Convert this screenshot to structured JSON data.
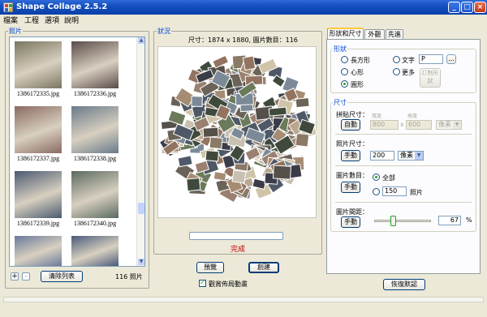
{
  "window": {
    "title": "Shape Collage 2.5.2",
    "min": "_",
    "max": "□",
    "close": "×"
  },
  "menu": [
    "檔案",
    "工程",
    "選項",
    "說明"
  ],
  "photos_panel": {
    "label": "照片",
    "items": [
      {
        "name": "1386172335.jpg",
        "color": "#7a7660"
      },
      {
        "name": "1386172336.jpg",
        "color": "#5a4a48"
      },
      {
        "name": "1386172337.jpg",
        "color": "#8a6a60"
      },
      {
        "name": "1386172338.jpg",
        "color": "#6a7a8a"
      },
      {
        "name": "1386172339.jpg",
        "color": "#4a5a70"
      },
      {
        "name": "1386172340.jpg",
        "color": "#5a6a60"
      },
      {
        "name": "",
        "color": "#6a7a9a"
      },
      {
        "name": "",
        "color": "#4a5a7a"
      }
    ],
    "add": "+",
    "remove": "-",
    "clear_list": "清除列表",
    "count": "116 照片"
  },
  "status_panel": {
    "label": "狀況",
    "info": "尺寸：1874 x 1880, 圖片數目：116",
    "done": "完成",
    "preview": "預覽",
    "create": "創建",
    "watch_layout": "觀賞佈局動畫"
  },
  "settings": {
    "tabs": [
      "形狀和尺寸",
      "外觀",
      "先進"
    ],
    "shape_group": "形狀",
    "shapes": {
      "rect": "長方形",
      "heart": "心形",
      "circle": "圓形",
      "text": "文字",
      "more": "更多"
    },
    "text_value": "P",
    "browse": "...",
    "custom_shape": "訂制形狀",
    "size_group": "尺寸",
    "collage_size": "拼貼尺寸：",
    "auto": "自動",
    "width_label": "寬度",
    "height_label": "高度",
    "width": "800",
    "height": "600",
    "x": "x",
    "unit_disabled": "像素",
    "photo_size": "照片尺寸：",
    "manual": "手動",
    "photo_size_value": "200",
    "unit": "像素",
    "photo_count": "圖片數目：",
    "all": "全部",
    "count_value": "150",
    "count_unit": "照片",
    "spacing": "圖片間距：",
    "spacing_value": "67",
    "spacing_pct": "%",
    "spacing_level": 0.67,
    "restore": "恢復默認"
  }
}
